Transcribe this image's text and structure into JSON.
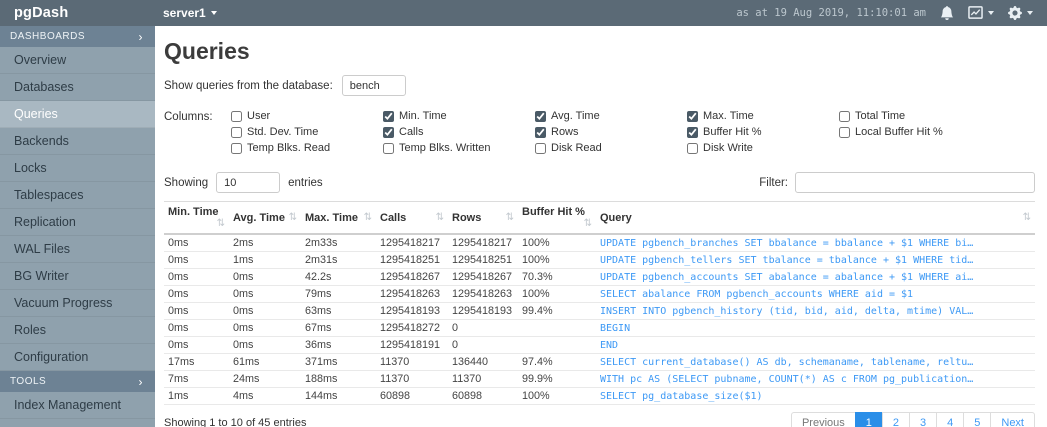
{
  "topbar": {
    "brand": "pgDash",
    "server": "server1",
    "timestamp": "as at 19 Aug 2019, 11:10:01 am",
    "icons": [
      "bell-icon",
      "charts-dropdown-icon",
      "settings-dropdown-icon"
    ]
  },
  "sidebar": {
    "sections": [
      {
        "label": "DASHBOARDS",
        "chevron": "›",
        "items": [
          "Overview",
          "Databases",
          "Queries",
          "Backends",
          "Locks",
          "Tablespaces",
          "Replication",
          "WAL Files",
          "BG Writer",
          "Vacuum Progress",
          "Roles",
          "Configuration"
        ],
        "active_item": "Queries"
      },
      {
        "label": "TOOLS",
        "chevron": "›",
        "items": [
          "Index Management"
        ]
      }
    ]
  },
  "page": {
    "title": "Queries",
    "database_label": "Show queries from the database:",
    "database_value": "bench"
  },
  "columns_selector": {
    "label": "Columns:",
    "groups": [
      [
        {
          "label": "User",
          "checked": false
        },
        {
          "label": "Std. Dev. Time",
          "checked": false
        },
        {
          "label": "Temp Blks. Read",
          "checked": false
        }
      ],
      [
        {
          "label": "Min. Time",
          "checked": true
        },
        {
          "label": "Calls",
          "checked": true
        },
        {
          "label": "Temp Blks. Written",
          "checked": false
        }
      ],
      [
        {
          "label": "Avg. Time",
          "checked": true
        },
        {
          "label": "Rows",
          "checked": true
        },
        {
          "label": "Disk Read",
          "checked": false
        }
      ],
      [
        {
          "label": "Max. Time",
          "checked": true
        },
        {
          "label": "Buffer Hit %",
          "checked": true
        },
        {
          "label": "Disk Write",
          "checked": false
        }
      ],
      [
        {
          "label": "Total Time",
          "checked": false
        },
        {
          "label": "Local Buffer Hit %",
          "checked": false
        }
      ]
    ]
  },
  "entries_control": {
    "prefix": "Showing",
    "value": "10",
    "suffix": "entries"
  },
  "filter": {
    "label": "Filter:",
    "value": ""
  },
  "table": {
    "sort_icon": "⇅",
    "headers": [
      "Min. Time",
      "Avg. Time",
      "Max. Time",
      "Calls",
      "Rows",
      "Buffer Hit %",
      "Query"
    ],
    "rows": [
      [
        "0ms",
        "2ms",
        "2m33s",
        "1295418217",
        "1295418217",
        "100%",
        "UPDATE pgbench_branches SET bbalance = bbalance + $1 WHERE bi…"
      ],
      [
        "0ms",
        "1ms",
        "2m31s",
        "1295418251",
        "1295418251",
        "100%",
        "UPDATE pgbench_tellers SET tbalance = tbalance + $1 WHERE tid…"
      ],
      [
        "0ms",
        "0ms",
        "42.2s",
        "1295418267",
        "1295418267",
        "70.3%",
        "UPDATE pgbench_accounts SET abalance = abalance + $1 WHERE ai…"
      ],
      [
        "0ms",
        "0ms",
        "79ms",
        "1295418263",
        "1295418263",
        "100%",
        "SELECT abalance FROM pgbench_accounts WHERE aid = $1"
      ],
      [
        "0ms",
        "0ms",
        "63ms",
        "1295418193",
        "1295418193",
        "99.4%",
        "INSERT INTO pgbench_history (tid, bid, aid, delta, mtime) VAL…"
      ],
      [
        "0ms",
        "0ms",
        "67ms",
        "1295418272",
        "0",
        "",
        "BEGIN"
      ],
      [
        "0ms",
        "0ms",
        "36ms",
        "1295418191",
        "0",
        "",
        "END"
      ],
      [
        "17ms",
        "61ms",
        "371ms",
        "11370",
        "136440",
        "97.4%",
        "SELECT current_database() AS db, schemaname, tablename, reltu…"
      ],
      [
        "7ms",
        "24ms",
        "188ms",
        "11370",
        "11370",
        "99.9%",
        "WITH pc AS (SELECT pubname, COUNT(*) AS c FROM pg_publication…"
      ],
      [
        "1ms",
        "4ms",
        "144ms",
        "60898",
        "60898",
        "100%",
        "SELECT pg_database_size($1)"
      ]
    ],
    "summary": "Showing 1 to 10 of 45 entries"
  },
  "pagination": {
    "previous": "Previous",
    "pages": [
      "1",
      "2",
      "3",
      "4",
      "5"
    ],
    "active_page": "1",
    "next": "Next"
  },
  "colors": {
    "topbar_bg": "#5b6a76",
    "sidebar_bg": "#8fa1ad",
    "sidebar_section_bg": "#6d8294",
    "sidebar_active_bg": "#a9b8c2",
    "query_link_blue": "#3d99f5",
    "pagination_active_blue": "#2a8ee8"
  }
}
